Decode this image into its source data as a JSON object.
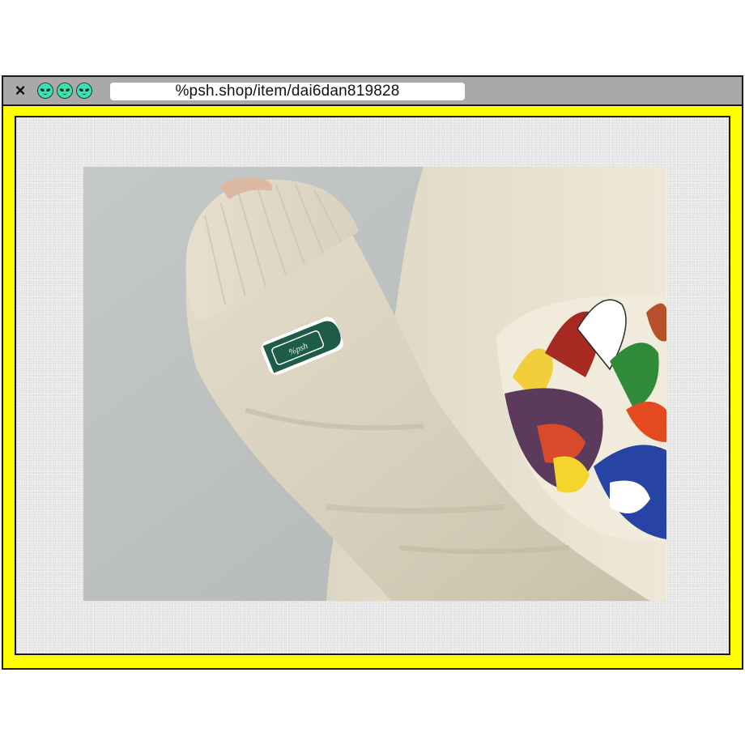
{
  "browser": {
    "close_icon": "×",
    "url": "%psh.shop/item/dai6dan819828",
    "dots": [
      "alien-icon",
      "alien-icon",
      "alien-icon"
    ],
    "dot_color": "#36e3b0"
  },
  "colors": {
    "frame": "#ffff00",
    "titlebar": "#a9a9a9",
    "patch": "#1d5c49",
    "fabric": "#e2dccb"
  },
  "product": {
    "patch_text": "%psh"
  }
}
